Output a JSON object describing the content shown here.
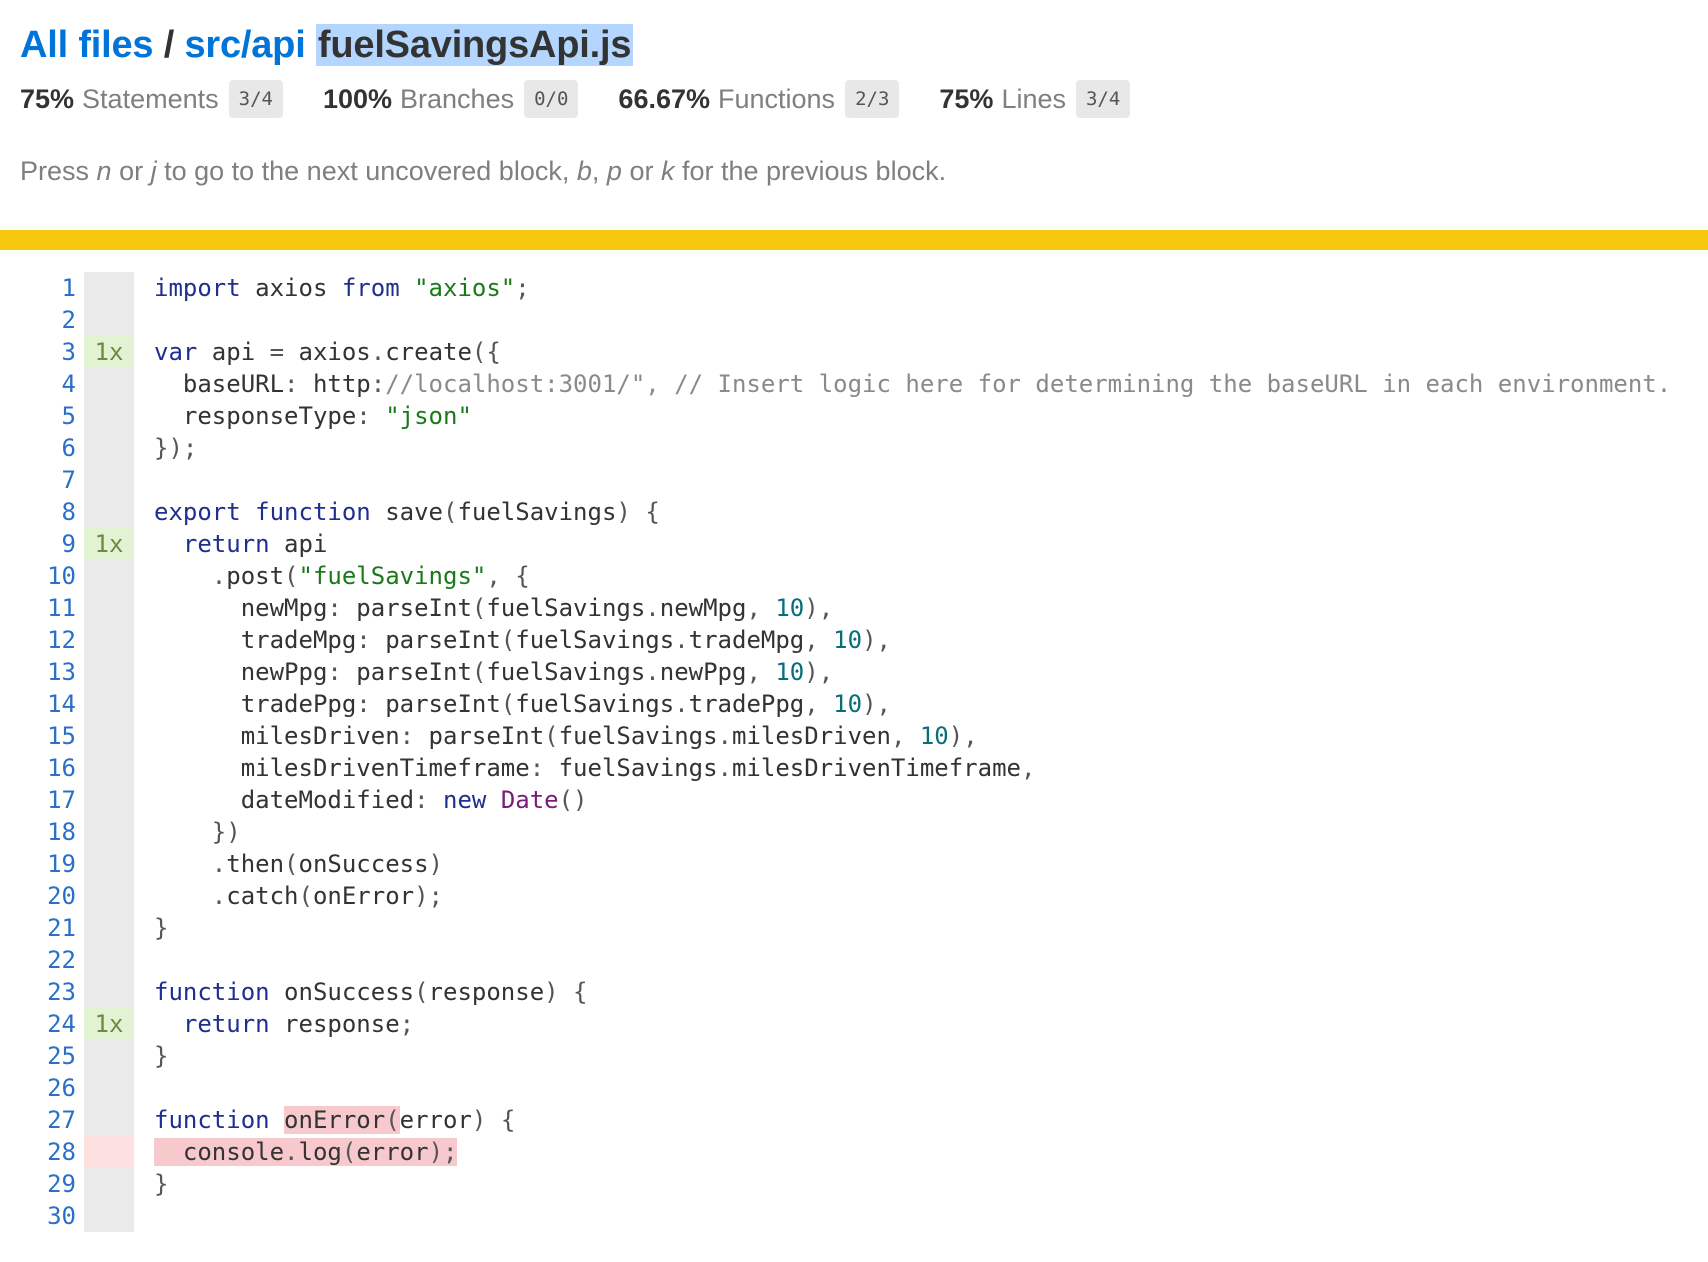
{
  "breadcrumb": {
    "all_files": "All files",
    "separator": "/",
    "dir": "src/api",
    "file": "fuelSavingsApi.js"
  },
  "summary": [
    {
      "pct": "75%",
      "label": "Statements",
      "fraction": "3/4"
    },
    {
      "pct": "100%",
      "label": "Branches",
      "fraction": "0/0"
    },
    {
      "pct": "66.67%",
      "label": "Functions",
      "fraction": "2/3"
    },
    {
      "pct": "75%",
      "label": "Lines",
      "fraction": "3/4"
    }
  ],
  "hint": {
    "t1": "Press ",
    "k1": "n",
    "t2": " or ",
    "k2": "j",
    "t3": " to go to the next uncovered block, ",
    "k3": "b",
    "t4": ", ",
    "k4": "p",
    "t5": " or ",
    "k5": "k",
    "t6": " for the previous block."
  },
  "colors": {
    "status_bar": "#f6c90e",
    "link": "#0074D9",
    "hit": "#e4f2d4",
    "miss": "#fde0e0"
  },
  "line_numbers": [
    "1",
    "2",
    "3",
    "4",
    "5",
    "6",
    "7",
    "8",
    "9",
    "10",
    "11",
    "12",
    "13",
    "14",
    "15",
    "16",
    "17",
    "18",
    "19",
    "20",
    "21",
    "22",
    "23",
    "24",
    "25",
    "26",
    "27",
    "28",
    "29",
    "30"
  ],
  "hit_counts": [
    "",
    "",
    "1x",
    "",
    "",
    "",
    "",
    "",
    "1x",
    "",
    "",
    "",
    "",
    "",
    "",
    "",
    "",
    "",
    "",
    "",
    "",
    "",
    "",
    "1x",
    "",
    "",
    "",
    "",
    "",
    ""
  ],
  "code_lines": [
    "import axios from \"axios\";",
    "",
    "var api = axios.create({",
    "  baseURL: \"http://localhost:3001/\", // Insert logic here for determining the baseURL in each environment.",
    "  responseType: \"json\"",
    "});",
    "",
    "export function save(fuelSavings) {",
    "  return api",
    "    .post(\"fuelSavings\", {",
    "      newMpg: parseInt(fuelSavings.newMpg, 10),",
    "      tradeMpg: parseInt(fuelSavings.tradeMpg, 10),",
    "      newPpg: parseInt(fuelSavings.newPpg, 10),",
    "      tradePpg: parseInt(fuelSavings.tradePpg, 10),",
    "      milesDriven: parseInt(fuelSavings.milesDriven, 10),",
    "      milesDrivenTimeframe: fuelSavings.milesDrivenTimeframe,",
    "      dateModified: new Date()",
    "    })",
    "    .then(onSuccess)",
    "    .catch(onError);",
    "}",
    "",
    "function onSuccess(response) {",
    "  return response;",
    "}",
    "",
    "function onError(error) {",
    "  console.log(error);",
    "}",
    ""
  ]
}
